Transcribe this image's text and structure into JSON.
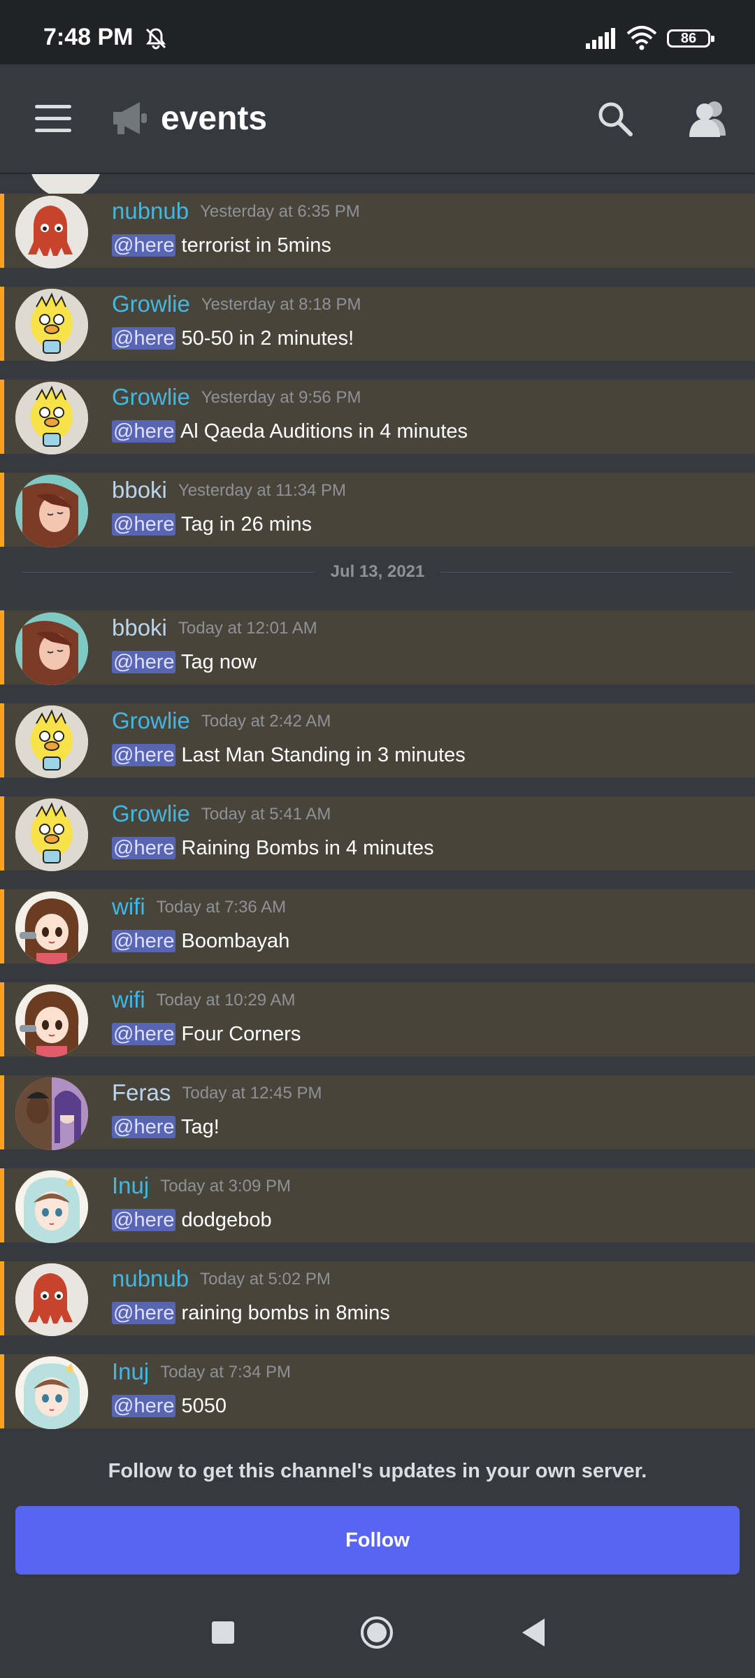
{
  "status_bar": {
    "time": "7:48 PM",
    "battery": "86"
  },
  "header": {
    "channel_name": "events"
  },
  "mention_label": "@here",
  "messages": [
    {
      "author": "nubnub",
      "timestamp": "Yesterday at 6:35 PM",
      "text": "terrorist in 5mins",
      "avatar": "squid-avatar"
    },
    {
      "author": "Growlie",
      "timestamp": "Yesterday at 8:18 PM",
      "text": "50-50 in 2 minutes!",
      "avatar": "duck-avatar"
    },
    {
      "author": "Growlie",
      "timestamp": "Yesterday at 9:56 PM",
      "text": "Al Qaeda Auditions in 4 minutes",
      "avatar": "duck-avatar"
    },
    {
      "author": "bboki",
      "timestamp": "Yesterday at 11:34 PM",
      "text": "Tag in 26 mins",
      "avatar": "anime-avatar"
    },
    {
      "author": "bboki",
      "timestamp": "Today at 12:01 AM",
      "text": "Tag now",
      "avatar": "anime-avatar"
    },
    {
      "author": "Growlie",
      "timestamp": "Today at 2:42 AM",
      "text": "Last Man Standing in 3 minutes",
      "avatar": "duck-avatar"
    },
    {
      "author": "Growlie",
      "timestamp": "Today at 5:41 AM",
      "text": "Raining Bombs in 4 minutes",
      "avatar": "duck-avatar"
    },
    {
      "author": "wifi",
      "timestamp": "Today at 7:36 AM",
      "text": "Boombayah",
      "avatar": "girl-avatar"
    },
    {
      "author": "wifi",
      "timestamp": "Today at 10:29 AM",
      "text": "Four Corners",
      "avatar": "girl-avatar"
    },
    {
      "author": "Feras",
      "timestamp": "Today at 12:45 PM",
      "text": "Tag!",
      "avatar": "photo-avatar"
    },
    {
      "author": "Inuj",
      "timestamp": "Today at 3:09 PM",
      "text": "dodgebob",
      "avatar": "boy-avatar"
    },
    {
      "author": "nubnub",
      "timestamp": "Today at 5:02 PM",
      "text": "raining bombs in 8mins",
      "avatar": "squid-avatar"
    },
    {
      "author": "Inuj",
      "timestamp": "Today at 7:34 PM",
      "text": "5050",
      "avatar": "boy-avatar"
    }
  ],
  "date_divider": "Jul 13, 2021",
  "footer": {
    "prompt": "Follow to get this channel's updates in your own server.",
    "follow_label": "Follow"
  },
  "colors": {
    "accent": "#5865f2",
    "mention_highlight_bar": "#faa61a",
    "highlighted_message_bg": "#49443a",
    "username_blue": "#40b7e5"
  }
}
